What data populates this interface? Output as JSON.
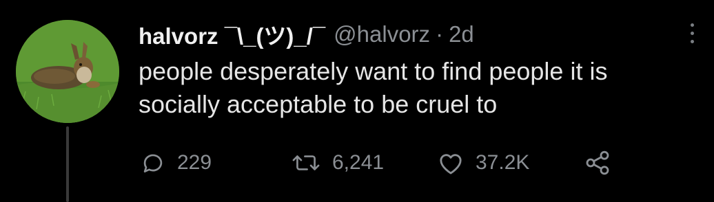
{
  "tweet": {
    "display_name": "halvorz ¯\\_(ツ)_/¯",
    "handle": "@halvorz",
    "separator": "·",
    "time": "2d",
    "text_lines": [
      "people desperately want to find people it is",
      "socially acceptable to be cruel to"
    ],
    "avatar": {
      "icon": "hare-in-grass-photo"
    },
    "menu_icon": "more-vertical-icon"
  },
  "actions": {
    "reply": {
      "icon": "reply-icon",
      "count": "229"
    },
    "retweet": {
      "icon": "retweet-icon",
      "count": "6,241"
    },
    "like": {
      "icon": "heart-icon",
      "count": "37.2K"
    },
    "share": {
      "icon": "share-icon"
    }
  },
  "colors": {
    "background": "#000000",
    "text": "#e6e6e6",
    "muted": "#8b8f94"
  }
}
